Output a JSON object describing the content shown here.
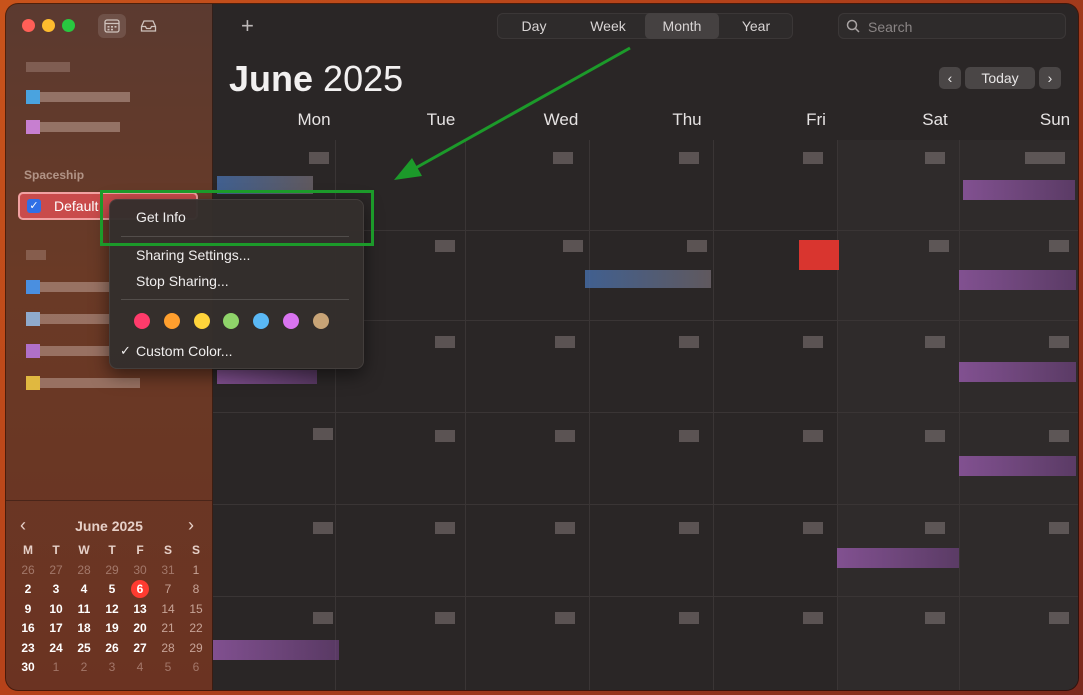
{
  "view_switcher": [
    "Day",
    "Week",
    "Month",
    "Year"
  ],
  "active_view": "Month",
  "search": {
    "placeholder": "Search"
  },
  "header": {
    "month": "June",
    "year": "2025",
    "today_label": "Today"
  },
  "weekdays": [
    "Mon",
    "Tue",
    "Wed",
    "Thu",
    "Fri",
    "Sat",
    "Sun"
  ],
  "sidebar": {
    "section_title": "Spaceship",
    "selected_calendar": "Default"
  },
  "context_menu": {
    "get_info": "Get Info",
    "sharing_settings": "Sharing Settings...",
    "stop_sharing": "Stop Sharing...",
    "custom_color": "Custom Color...",
    "color_swatches": [
      "#ff3b6b",
      "#ff9f2e",
      "#ffd43b",
      "#8fd46a",
      "#5ab8f5",
      "#d974f0",
      "#c8a477"
    ]
  },
  "mini_calendar": {
    "title": "June 2025",
    "headers": [
      "M",
      "T",
      "W",
      "T",
      "F",
      "S",
      "S"
    ],
    "weeks": [
      [
        "26",
        "27",
        "28",
        "29",
        "30",
        "31",
        "1"
      ],
      [
        "2",
        "3",
        "4",
        "5",
        "6",
        "7",
        "8"
      ],
      [
        "9",
        "10",
        "11",
        "12",
        "13",
        "14",
        "15"
      ],
      [
        "16",
        "17",
        "18",
        "19",
        "20",
        "21",
        "22"
      ],
      [
        "23",
        "24",
        "25",
        "26",
        "27",
        "28",
        "29"
      ],
      [
        "30",
        "1",
        "2",
        "3",
        "4",
        "5",
        "6"
      ]
    ],
    "today": "6"
  },
  "colors": {
    "annotation": "#1c9a2a",
    "today": "#ff3b30",
    "accent": "#2f6fe6"
  }
}
